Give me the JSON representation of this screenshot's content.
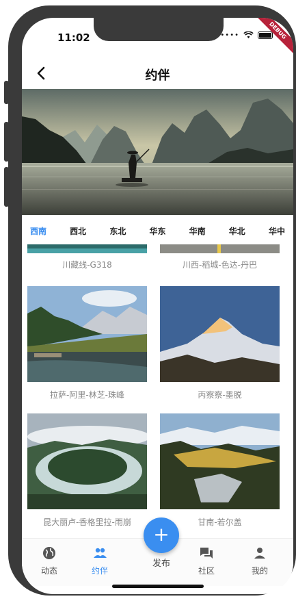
{
  "status": {
    "time": "11:02",
    "debug": "DEBUG"
  },
  "appbar": {
    "title": "约伴"
  },
  "tabs": [
    "西南",
    "西北",
    "东北",
    "华东",
    "华南",
    "华北",
    "华中"
  ],
  "cards": [
    {
      "label": "川藏线-G318"
    },
    {
      "label": "川西-稻城-色达-丹巴"
    },
    {
      "label": "拉萨-阿里-林芝-珠峰"
    },
    {
      "label": "丙察察-墨脱"
    },
    {
      "label": "昆大丽卢-香格里拉-雨崩"
    },
    {
      "label": "甘南-若尔盖"
    }
  ],
  "nav": {
    "items": [
      {
        "label": "动态",
        "icon": "globe-icon"
      },
      {
        "label": "约伴",
        "icon": "people-icon"
      },
      {
        "label": "社区",
        "icon": "chat-icon"
      },
      {
        "label": "我的",
        "icon": "person-icon"
      }
    ],
    "fab_symbol": "+",
    "fab_label": "发布"
  },
  "colors": {
    "accent": "#3a8ef0"
  }
}
